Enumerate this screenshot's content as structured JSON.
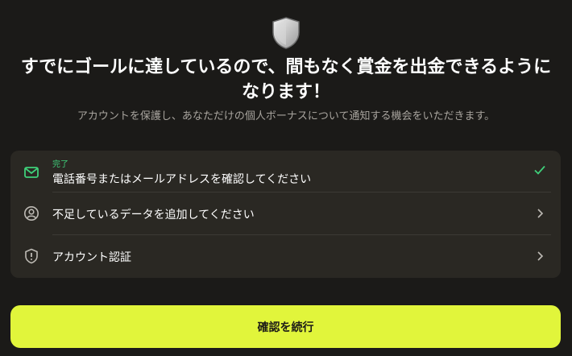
{
  "header": {
    "title": "すでにゴールに達しているので、間もなく賞金を出金できるようになります！",
    "subtitle": "アカウントを保護し、あなただけの個人ボーナスについて通知する機会をいただきます。"
  },
  "steps": [
    {
      "badge": "完了",
      "label": "電話番号またはメールアドレスを確認してください",
      "icon": "mail-icon",
      "status": "check-icon"
    },
    {
      "label": "不足しているデータを追加してください",
      "icon": "user-circle-icon",
      "status": "chevron-right-icon"
    },
    {
      "label": "アカウント認証",
      "icon": "shield-alert-icon",
      "status": "chevron-right-icon"
    }
  ],
  "cta": {
    "label": "確認を続行"
  },
  "colors": {
    "background": "#1b1a18",
    "card": "#2a2823",
    "accent": "#e1f53b",
    "success": "#3fd07a",
    "muted": "#a8a49e"
  }
}
